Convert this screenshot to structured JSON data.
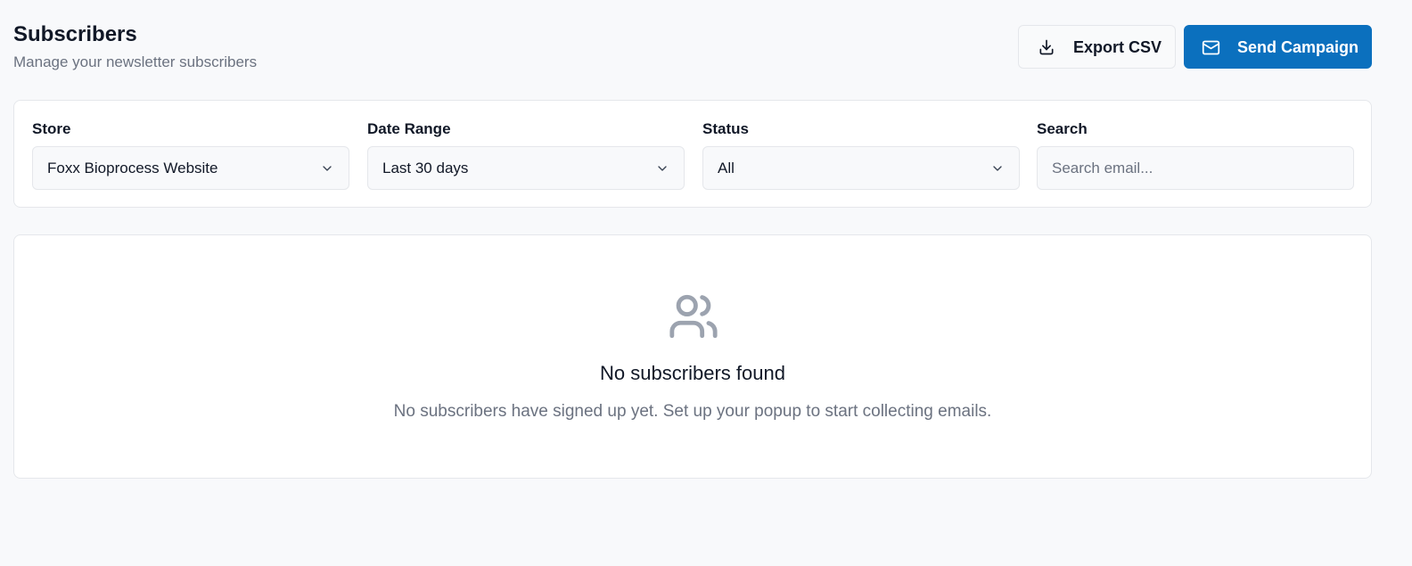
{
  "header": {
    "title": "Subscribers",
    "subtitle": "Manage your newsletter subscribers"
  },
  "actions": {
    "export_label": "Export CSV",
    "export_icon": "download-icon",
    "send_label": "Send Campaign",
    "send_icon": "mail-icon"
  },
  "filters": {
    "store": {
      "label": "Store",
      "value": "Foxx Bioprocess Website"
    },
    "date_range": {
      "label": "Date Range",
      "value": "Last 30 days"
    },
    "status": {
      "label": "Status",
      "value": "All"
    },
    "search": {
      "label": "Search",
      "value": "",
      "placeholder": "Search email..."
    }
  },
  "empty_state": {
    "icon": "users-icon",
    "title": "No subscribers found",
    "message": "No subscribers have signed up yet. Set up your popup to start collecting emails."
  },
  "colors": {
    "primary": "#0b70be",
    "background": "#f8f9fb",
    "muted_text": "#6b7280",
    "icon_muted": "#9ca3af"
  }
}
